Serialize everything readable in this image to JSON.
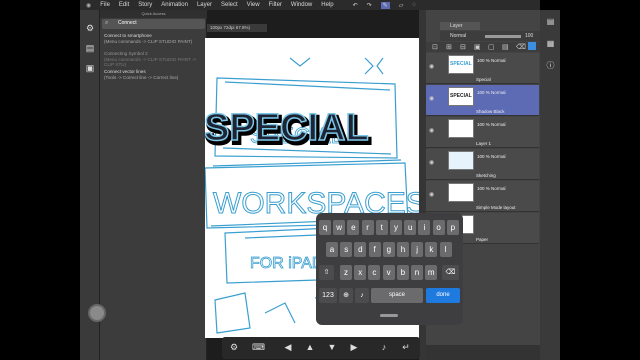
{
  "menu": [
    "File",
    "Edit",
    "Story",
    "Animation",
    "Layer",
    "Select",
    "View",
    "Filter",
    "Window",
    "Help"
  ],
  "quick_access": {
    "title": "Quick Access",
    "search_value": "Connect",
    "items": [
      {
        "title": "Connect to smartphone",
        "sub": "(Menu commands -> CLIP STUDIO PAINT)"
      },
      {
        "title": "Connecting Symbol 2",
        "sub": "(Menu commands -> CLIP STUDIO PAINT -> CLIP STU)"
      },
      {
        "title": "Connect vector lines",
        "sub": "(Tools -> Correct line -> Correct line)"
      }
    ]
  },
  "canvas": {
    "tab_label": "100px 72dpi 67.8%)",
    "heading_text": "SPECIAL",
    "sketch_text_1": "WORKSPACES",
    "sketch_text_2": "FOR iPAD"
  },
  "layers_panel": {
    "tab_label": "Layer",
    "blend_mode": "Normal",
    "opacity": "100",
    "layers": [
      {
        "pct": "100 % Normal",
        "name": "Special",
        "thumb_text": "SPECIAL",
        "selected": false
      },
      {
        "pct": "100 % Normal",
        "name": "Shadow Black",
        "thumb_text": "SPECIAL",
        "selected": true
      },
      {
        "pct": "100 % Normal",
        "name": "Layer 1",
        "thumb_text": "",
        "selected": false
      },
      {
        "pct": "100 % Normal",
        "name": "Sketching",
        "thumb_text": "",
        "selected": false
      },
      {
        "pct": "100 % Normal",
        "name": "Simple Mode layout",
        "thumb_text": "",
        "selected": false
      },
      {
        "pct": "",
        "name": "Paper",
        "thumb_text": "",
        "selected": false
      }
    ]
  },
  "keyboard": {
    "row1": [
      "q",
      "w",
      "e",
      "r",
      "t",
      "y",
      "u",
      "i",
      "o",
      "p"
    ],
    "row2": [
      "a",
      "s",
      "d",
      "f",
      "g",
      "h",
      "j",
      "k",
      "l"
    ],
    "row3": [
      "z",
      "x",
      "c",
      "v",
      "b",
      "n",
      "m"
    ],
    "numbers_label": "123",
    "space_label": "space",
    "done_label": "done"
  },
  "colors": {
    "accent_blue": "#1f7ae0",
    "selected_layer": "#5d6bb4",
    "sketch_blue": "#3a9fd0"
  }
}
